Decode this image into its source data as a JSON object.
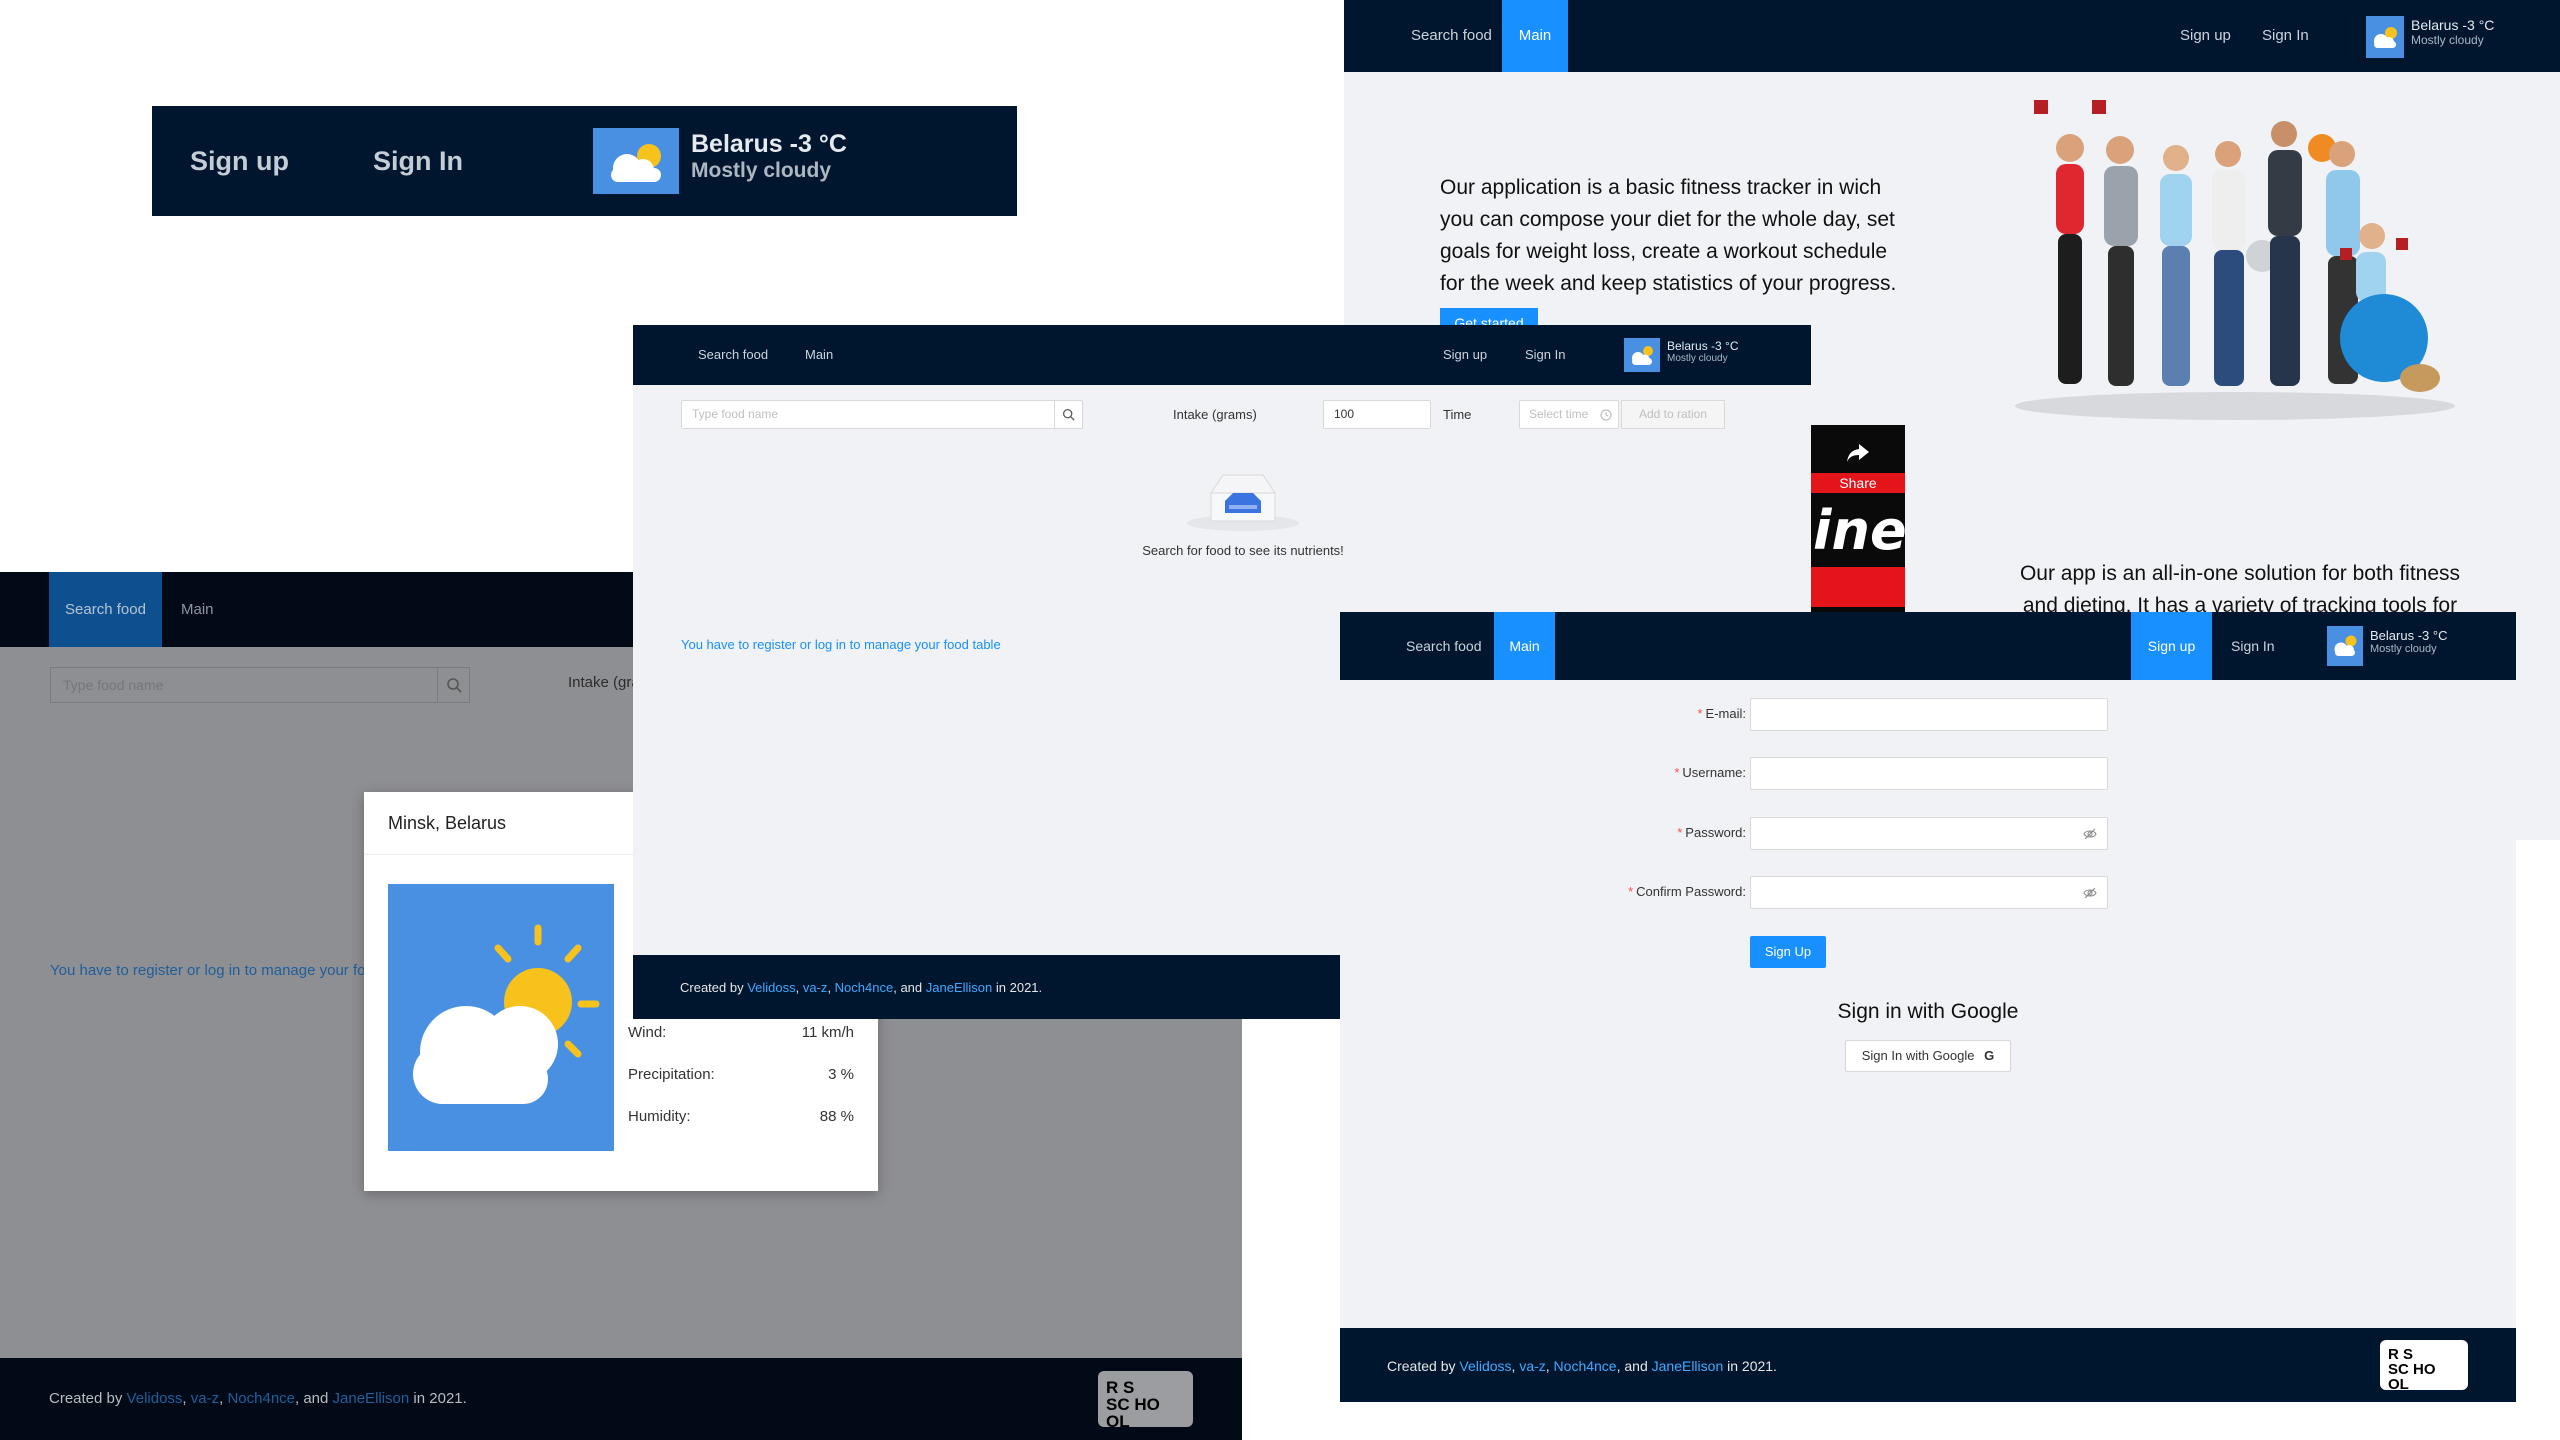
{
  "zoom_panel": {
    "sign_up": "Sign up",
    "sign_in": "Sign In",
    "weather_city": "Belarus",
    "weather_temp": "-3 °C",
    "weather_desc": "Mostly cloudy"
  },
  "main_page": {
    "nav": {
      "search_food": "Search food",
      "main": "Main",
      "sign_up": "Sign up",
      "sign_in": "Sign In"
    },
    "weather": {
      "city": "Belarus",
      "temp": "-3 °C",
      "desc": "Mostly cloudy"
    },
    "intro_text": "Our application is a basic fitness tracker in wich you can compose your diet for the whole day, set goals for weight loss, create a workout schedule for the week and keep statistics of your progress.",
    "start_button": "Get started",
    "solution_text": "Our app is an all-in-one solution for both fitness and dieting. It has a variety of tracking tools for both"
  },
  "video_overlay": {
    "share_label": "Share",
    "caption": "ined"
  },
  "search_food_bg": {
    "nav": {
      "search_food": "Search food",
      "main": "Main"
    },
    "search_placeholder": "Type food name",
    "intake_label": "Intake (gra",
    "register_message": "You have to register or log in to manage your food",
    "footer": {
      "prefix": "Created by",
      "authors": [
        "Velidoss",
        "va-z",
        "Noch4nce",
        "JaneEllison"
      ],
      "suffix": "in 2021."
    },
    "logo": {
      "line1": "R S",
      "line2": "SC HO OL"
    }
  },
  "weather_modal": {
    "title": "Minsk, Belarus",
    "rows": [
      {
        "label": "Wind:",
        "value": "11 km/h"
      },
      {
        "label": "Precipitation:",
        "value": "3 %"
      },
      {
        "label": "Humidity:",
        "value": "88 %"
      }
    ]
  },
  "search_food_page": {
    "nav": {
      "search_food": "Search food",
      "main": "Main",
      "sign_up": "Sign up",
      "sign_in": "Sign In"
    },
    "weather": {
      "city": "Belarus",
      "temp": "-3 °C",
      "desc": "Mostly cloudy"
    },
    "search_placeholder": "Type food name",
    "intake_label": "Intake (grams)",
    "intake_value": "100",
    "time_label": "Time",
    "time_placeholder": "Select time",
    "add_button": "Add to ration",
    "empty_text": "Search for food to see its nutrients!",
    "register_message": "You have to register or log in to manage your food table",
    "footer": {
      "prefix": "Created by",
      "authors": [
        "Velidoss",
        "va-z",
        "Noch4nce",
        "JaneEllison"
      ],
      "suffix": "in 2021."
    }
  },
  "signup_page": {
    "nav": {
      "search_food": "Search food",
      "main": "Main",
      "sign_up": "Sign up",
      "sign_in": "Sign In"
    },
    "weather": {
      "city": "Belarus",
      "temp": "-3 °C",
      "desc": "Mostly cloudy"
    },
    "email_label": "E-mail",
    "username_label": "Username",
    "password_label": "Password",
    "confirm_label": "Confirm Password",
    "signup_button": "Sign Up",
    "google_heading": "Sign in with Google",
    "google_button": "Sign In with Google",
    "google_glyph": "G",
    "footer": {
      "prefix": "Created by",
      "authors": [
        "Velidoss",
        "va-z",
        "Noch4nce",
        "JaneEllison"
      ],
      "suffix": "in 2021."
    },
    "logo": {
      "line1": "R S",
      "line2": "SC HO OL"
    }
  },
  "colors": {
    "navy": "#00162f",
    "accent": "#1890ff",
    "page_bg": "#f0f2f5",
    "weather_blue": "#4a90e2"
  }
}
